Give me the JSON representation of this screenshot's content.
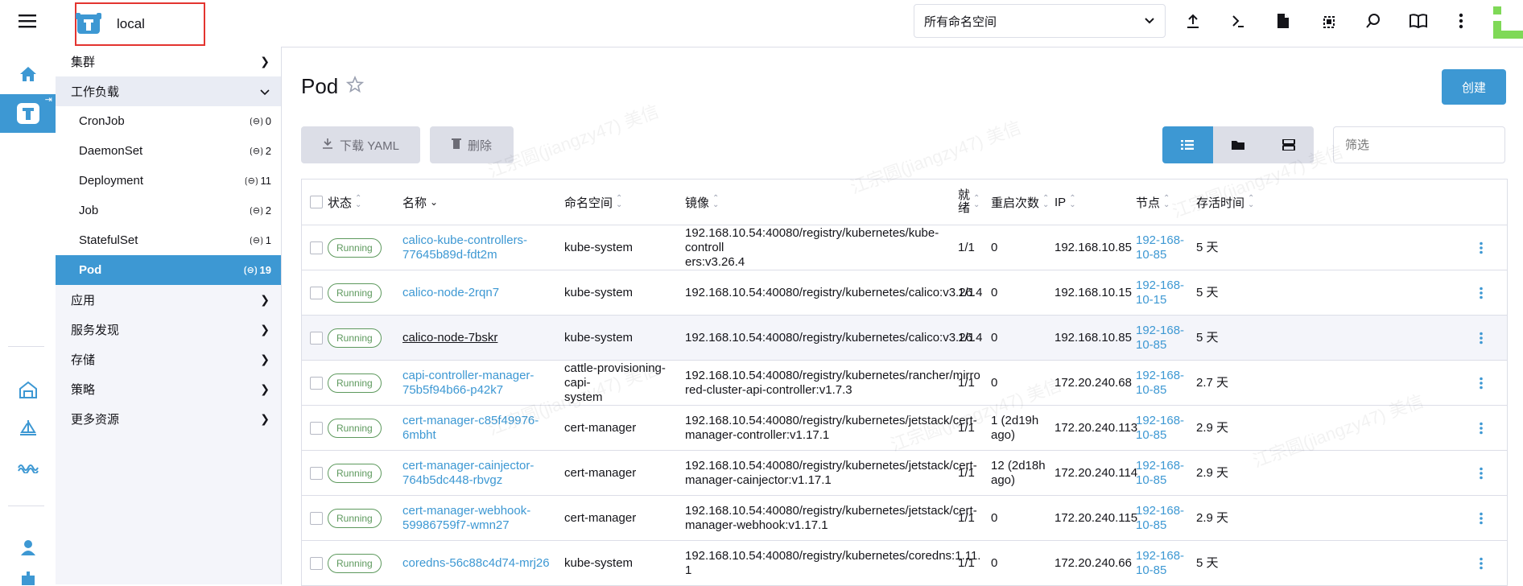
{
  "header": {
    "cluster_name": "local",
    "namespace_select": "所有命名空间"
  },
  "nav": {
    "cluster": "集群",
    "workload": "工作负载",
    "sub_items": [
      {
        "label": "CronJob",
        "count": "0"
      },
      {
        "label": "DaemonSet",
        "count": "2"
      },
      {
        "label": "Deployment",
        "count": "11"
      },
      {
        "label": "Job",
        "count": "2"
      },
      {
        "label": "StatefulSet",
        "count": "1"
      },
      {
        "label": "Pod",
        "count": "19"
      }
    ],
    "apps": "应用",
    "service_discovery": "服务发现",
    "storage": "存储",
    "policy": "策略",
    "more_resources": "更多资源"
  },
  "page": {
    "title": "Pod",
    "create": "创建",
    "download_yaml": "下载 YAML",
    "delete": "删除",
    "filter_placeholder": "筛选"
  },
  "table": {
    "headers": {
      "state": "状态",
      "name": "名称",
      "namespace": "命名空间",
      "image": "镜像",
      "ready_1": "就",
      "ready_2": "绪",
      "restarts": "重启次数",
      "ip": "IP",
      "node": "节点",
      "age": "存活时间"
    },
    "rows": [
      {
        "state": "Running",
        "name_1": "calico-kube-controllers-",
        "name_2": "77645b89d-fdt2m",
        "namespace_1": "kube-system",
        "namespace_2": "",
        "image_1": "192.168.10.54:40080/registry/kubernetes/kube-controll",
        "image_2": "ers:v3.26.4",
        "ready": "1/1",
        "restarts_1": "0",
        "restarts_2": "",
        "ip": "192.168.10.85",
        "node_1": "192-168-",
        "node_2": "10-85",
        "age": "5 天"
      },
      {
        "state": "Running",
        "name_1": "calico-node-2rqn7",
        "name_2": "",
        "namespace_1": "kube-system",
        "namespace_2": "",
        "image_1": "192.168.10.54:40080/registry/kubernetes/calico:v3.26.4",
        "image_2": "",
        "ready": "1/1",
        "restarts_1": "0",
        "restarts_2": "",
        "ip": "192.168.10.15",
        "node_1": "192-168-",
        "node_2": "10-15",
        "age": "5 天"
      },
      {
        "state": "Running",
        "name_1": "calico-node-7bskr",
        "name_2": "",
        "namespace_1": "kube-system",
        "namespace_2": "",
        "image_1": "192.168.10.54:40080/registry/kubernetes/calico:v3.26.4",
        "image_2": "",
        "ready": "1/1",
        "restarts_1": "0",
        "restarts_2": "",
        "ip": "192.168.10.85",
        "node_1": "192-168-",
        "node_2": "10-85",
        "age": "5 天"
      },
      {
        "state": "Running",
        "name_1": "capi-controller-manager-",
        "name_2": "75b5f94b66-p42k7",
        "namespace_1": "cattle-provisioning-capi-",
        "namespace_2": "system",
        "image_1": "192.168.10.54:40080/registry/kubernetes/rancher/mirro",
        "image_2": "red-cluster-api-controller:v1.7.3",
        "ready": "1/1",
        "restarts_1": "0",
        "restarts_2": "",
        "ip": "172.20.240.68",
        "node_1": "192-168-",
        "node_2": "10-85",
        "age": "2.7 天"
      },
      {
        "state": "Running",
        "name_1": "cert-manager-c85f49976-6mbht",
        "name_2": "",
        "namespace_1": "cert-manager",
        "namespace_2": "",
        "image_1": "192.168.10.54:40080/registry/kubernetes/jetstack/cert-",
        "image_2": "manager-controller:v1.17.1",
        "ready": "1/1",
        "restarts_1": "1 (2d19h",
        "restarts_2": "ago)",
        "ip": "172.20.240.113",
        "node_1": "192-168-",
        "node_2": "10-85",
        "age": "2.9 天"
      },
      {
        "state": "Running",
        "name_1": "cert-manager-cainjector-",
        "name_2": "764b5dc448-rbvgz",
        "namespace_1": "cert-manager",
        "namespace_2": "",
        "image_1": "192.168.10.54:40080/registry/kubernetes/jetstack/cert-",
        "image_2": "manager-cainjector:v1.17.1",
        "ready": "1/1",
        "restarts_1": "12 (2d18h",
        "restarts_2": "ago)",
        "ip": "172.20.240.114",
        "node_1": "192-168-",
        "node_2": "10-85",
        "age": "2.9 天"
      },
      {
        "state": "Running",
        "name_1": "cert-manager-webhook-",
        "name_2": "59986759f7-wmn27",
        "namespace_1": "cert-manager",
        "namespace_2": "",
        "image_1": "192.168.10.54:40080/registry/kubernetes/jetstack/cert-",
        "image_2": "manager-webhook:v1.17.1",
        "ready": "1/1",
        "restarts_1": "0",
        "restarts_2": "",
        "ip": "172.20.240.115",
        "node_1": "192-168-",
        "node_2": "10-85",
        "age": "2.9 天"
      },
      {
        "state": "Running",
        "name_1": "coredns-56c88c4d74-mrj26",
        "name_2": "",
        "namespace_1": "kube-system",
        "namespace_2": "",
        "image_1": "192.168.10.54:40080/registry/kubernetes/coredns:1.11.",
        "image_2": "1",
        "ready": "1/1",
        "restarts_1": "0",
        "restarts_2": "",
        "ip": "172.20.240.66",
        "node_1": "192-168-",
        "node_2": "10-85",
        "age": "5 天"
      }
    ]
  },
  "colors": {
    "accent": "#3d98d3",
    "running": "#5d995d",
    "highlight_box": "#e3342f"
  },
  "watermark": "江宗圆(jiangzy47) 美信"
}
